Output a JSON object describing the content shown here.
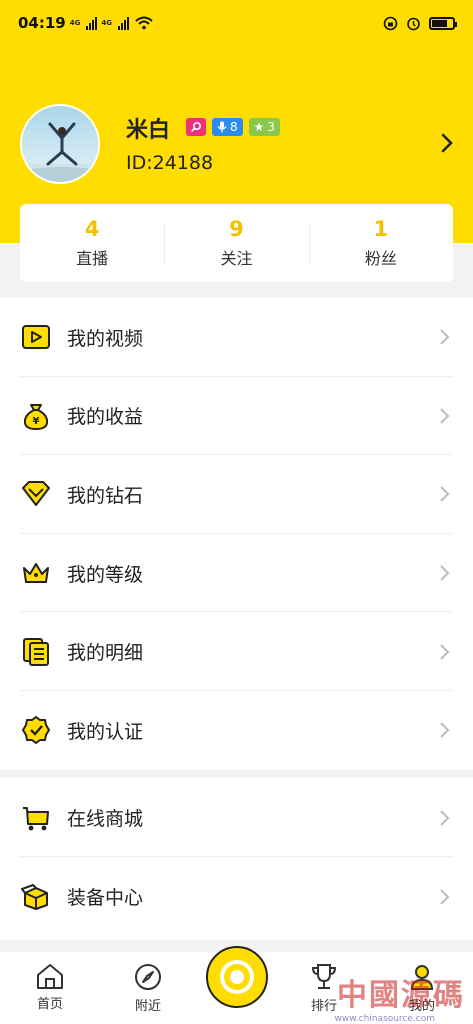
{
  "status_bar": {
    "time": "04:19",
    "network_1": "4G",
    "network_2": "4G"
  },
  "profile": {
    "name": "米白",
    "id_text": "ID:24188",
    "badges": {
      "anchor_level": "8",
      "star_level": "3"
    }
  },
  "stats": [
    {
      "value": "4",
      "label": "直播"
    },
    {
      "value": "9",
      "label": "关注"
    },
    {
      "value": "1",
      "label": "粉丝"
    }
  ],
  "menu": [
    {
      "label": "我的视频",
      "icon": "video-icon"
    },
    {
      "label": "我的收益",
      "icon": "money-bag-icon"
    },
    {
      "label": "我的钻石",
      "icon": "diamond-icon"
    },
    {
      "label": "我的等级",
      "icon": "crown-icon"
    },
    {
      "label": "我的明细",
      "icon": "ledger-icon"
    },
    {
      "label": "我的认证",
      "icon": "verified-badge-icon"
    }
  ],
  "menu2": [
    {
      "label": "在线商城",
      "icon": "cart-icon"
    },
    {
      "label": "装备中心",
      "icon": "box-icon"
    }
  ],
  "nav": [
    {
      "label": "首页",
      "icon": "home-icon"
    },
    {
      "label": "附近",
      "icon": "compass-icon"
    },
    {
      "label": "",
      "icon": "record-icon"
    },
    {
      "label": "排行",
      "icon": "trophy-icon"
    },
    {
      "label": "我的",
      "icon": "profile-icon"
    }
  ],
  "watermark": {
    "text": "中國源碼",
    "url": "www.chinasource.com"
  },
  "colors": {
    "accent": "#ffdd00",
    "number": "#f2c100",
    "badge_pink": "#ef2f7b",
    "badge_blue": "#2a8bf0",
    "badge_green": "#8ac84a"
  }
}
